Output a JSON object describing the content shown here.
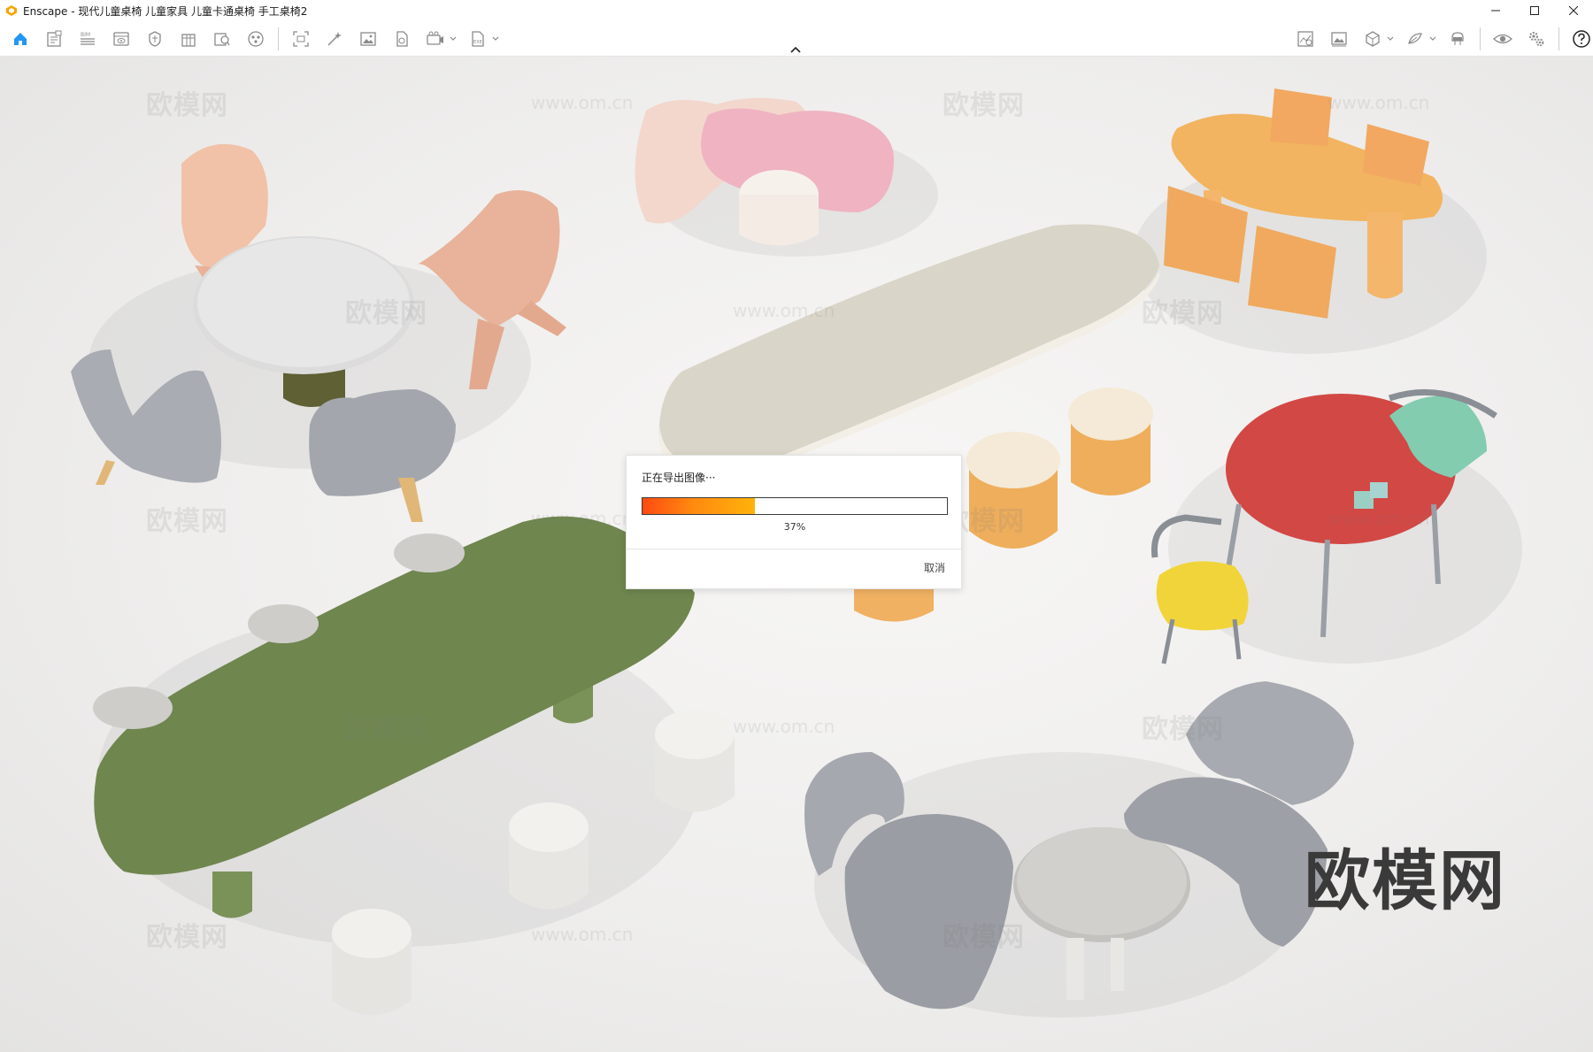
{
  "window": {
    "title": "Enscape - 现代儿童桌椅 儿童家具 儿童卡通桌椅 手工桌椅2",
    "controls": [
      "minimize-icon",
      "maximize-icon",
      "close-icon"
    ]
  },
  "toolbar": {
    "left_icons": [
      "home-icon",
      "notes-icon",
      "bim-icon",
      "views-icon",
      "atmosphere-icon",
      "building-icon",
      "asset-library-icon",
      "material-icon",
      "screenshot-icon",
      "batch-render-icon",
      "image-export-icon",
      "panorama-icon",
      "video-icon",
      "exe-export-icon"
    ],
    "right_icons": [
      "capture-icon",
      "gallery-icon",
      "cube-icon",
      "sketch-icon",
      "vr-headset-icon",
      "visibility-icon",
      "settings-icon",
      "help-icon"
    ],
    "accent_color": "#2196f3"
  },
  "viewport": {
    "watermarks": {
      "brand": "欧模网",
      "url": "www.om.cn"
    }
  },
  "dialog": {
    "message": "正在导出图像···",
    "progress_percent": 37,
    "progress_label": "37%",
    "cancel_label": "取消"
  }
}
